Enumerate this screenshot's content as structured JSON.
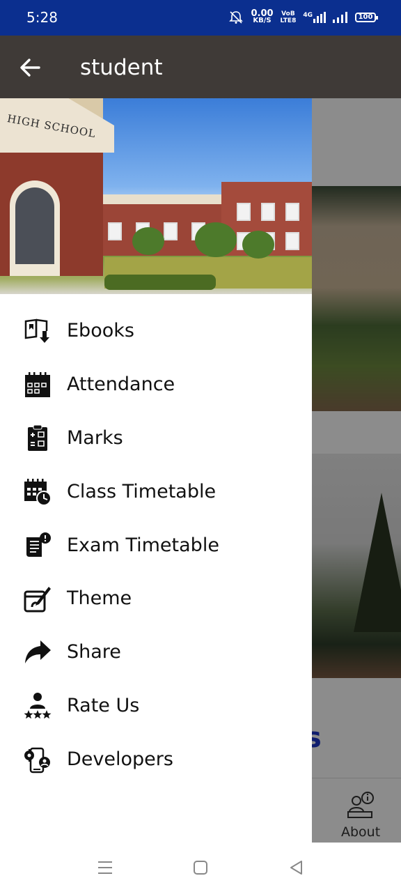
{
  "status_bar": {
    "time": "5:28",
    "net_speed_value": "0.00",
    "net_speed_unit": "KB/S",
    "volte_top": "VoB",
    "volte_bottom": "LTE8",
    "network_type": "4G",
    "battery": "100"
  },
  "app_bar": {
    "title": "student",
    "back_icon": "arrow-left-icon"
  },
  "drawer": {
    "header_sign": "HIGH SCHOOL",
    "menu": [
      {
        "label": "Ebooks",
        "icon": "ebook-download-icon"
      },
      {
        "label": "Attendance",
        "icon": "calendar-icon"
      },
      {
        "label": "Marks",
        "icon": "clipboard-marks-icon"
      },
      {
        "label": "Class Timetable",
        "icon": "calendar-clock-icon"
      },
      {
        "label": "Exam Timetable",
        "icon": "exam-scroll-icon"
      },
      {
        "label": "Theme",
        "icon": "theme-edit-icon"
      },
      {
        "label": "Share",
        "icon": "share-arrow-icon"
      },
      {
        "label": "Rate Us",
        "icon": "rate-user-stars-icon"
      },
      {
        "label": "Developers",
        "icon": "developer-gear-icon"
      }
    ]
  },
  "background_page": {
    "partial_text": "s",
    "bottom_nav": {
      "about_label": "About",
      "about_icon": "user-info-icon"
    }
  },
  "nav_bar": {
    "menu_icon": "menu-lines-icon",
    "home_icon": "square-home-icon",
    "back_icon": "triangle-back-icon"
  },
  "colors": {
    "status_bar": "#0b2f8f",
    "app_bar": "#3f3a37",
    "text": "#111111"
  }
}
